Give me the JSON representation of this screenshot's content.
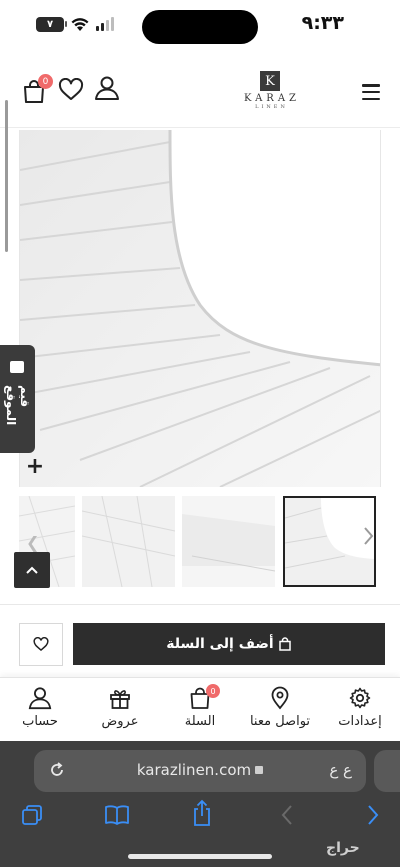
{
  "status_bar": {
    "time": "٩:٣٣",
    "battery": "٧"
  },
  "header": {
    "cart_count": "0",
    "logo": {
      "letter": "K",
      "name": "KARAZ",
      "sub": "LINEN"
    },
    "icons": [
      "cart-icon",
      "heart-icon",
      "user-icon",
      "menu-icon"
    ]
  },
  "feedback_tab": {
    "label": "قيم الموقع"
  },
  "product": {
    "add_to_cart_label": "أضف إلى السلة",
    "wishlist_icon": "heart-icon"
  },
  "bottom_nav": {
    "items": [
      {
        "label": "حساب",
        "icon": "user-icon"
      },
      {
        "label": "عروض",
        "icon": "gift-icon"
      },
      {
        "label": "السلة",
        "icon": "bag-icon",
        "badge": "0"
      },
      {
        "label": "تواصل معنا",
        "icon": "location-pin-icon"
      },
      {
        "label": "إعدادات",
        "icon": "gear-icon"
      }
    ]
  },
  "browser": {
    "url": "karazlinen.com",
    "aa_label": "ع ع",
    "toolbar_icons": [
      "tabs-icon",
      "bookmarks-icon",
      "share-icon",
      "back-icon",
      "forward-icon"
    ]
  },
  "watermark": "حراج",
  "colors": {
    "dark_button": "#2d2d2d",
    "badge": "#f06a6a",
    "safari_bg": "#3f3f3f",
    "link_blue": "#3a8ef6"
  }
}
